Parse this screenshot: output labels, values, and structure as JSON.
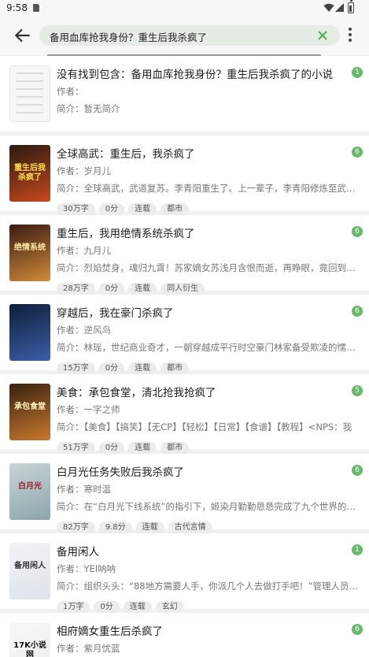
{
  "status_bar": {
    "time": "9:58"
  },
  "search": {
    "query": "备用血库抢我身份？重生后我杀疯了"
  },
  "results": [
    {
      "title": "没有找到包含：备用血库抢我身份？重生后我杀疯了的小说",
      "author": "作者：",
      "intro": "简介：暂无简介",
      "count": "1",
      "tags": [],
      "cover": {
        "style": "blank"
      }
    },
    {
      "title": "全球高武：重生后，我杀疯了",
      "author": "作者：岁月儿",
      "intro": "简介：全球高武，武道复苏。李青阳重生了。上一辈子，李青阳修炼至武道巅峰，",
      "count": "6",
      "tags": [
        "30万字",
        "0分",
        "连载",
        "都市"
      ],
      "cover": {
        "bg1": "#2a1a12",
        "bg2": "#c8481c",
        "text": "重生后我杀疯了",
        "fg": "#ffe04a"
      }
    },
    {
      "title": "重生后，我用绝情系统杀疯了",
      "author": "作者：九月儿",
      "intro": "简介：烈焰焚身，魂归九霄！苏家嫡女苏浅月含恨而逝，再睁眼，竟回到十五岁被",
      "count": "6",
      "tags": [
        "28万字",
        "0分",
        "连载",
        "同人衍生"
      ],
      "cover": {
        "bg1": "#3b1a12",
        "bg2": "#d08a3a",
        "text": "绝情系统",
        "fg": "#ffe9a8"
      }
    },
    {
      "title": "穿越后，我在豪门杀疯了",
      "author": "作者：逆风鸟",
      "intro": "简介：林瑶，世纪商业奇才，一朝穿越成平行时空豪门林家备受欺凌的懦弱千金",
      "count": "6",
      "tags": [
        "15万字",
        "0分",
        "连载",
        "都市"
      ],
      "cover": {
        "bg1": "#0f1d3a",
        "bg2": "#3a5fa8",
        "text": "",
        "fg": "#ffffff"
      }
    },
    {
      "title": "美食：承包食堂，清北抢我抢疯了",
      "author": "作者：一字之师",
      "intro": "简介：【美食】【搞笑】【无CP】【轻松】【日常】【食谱】【教程】<NPS：我",
      "count": "5",
      "tags": [
        "51万字",
        "0分",
        "连载",
        "都市"
      ],
      "cover": {
        "bg1": "#3a2210",
        "bg2": "#c9782e",
        "text": "承包食堂",
        "fg": "#fff2c0"
      }
    },
    {
      "title": "白月光任务失败后我杀疯了",
      "author": "作者：寒时温",
      "intro": "简介：在“白月光下线系统”的指引下，姬染月勤勤恳恳完成了九个世界的下线任务，",
      "count": "6",
      "tags": [
        "82万字",
        "9.8分",
        "连载",
        "古代言情"
      ],
      "cover": {
        "bg1": "#c9d4d6",
        "bg2": "#8aa7ab",
        "text": "白月光",
        "fg": "#a02030"
      }
    },
    {
      "title": "备用闲人",
      "author": "作者：YEI呐呐",
      "intro": "简介：组织头头：“88地方需要人手，你派几个人去做打手吧！”管理人员刷刷的查",
      "count": "1",
      "tags": [
        "1万字",
        "0分",
        "连载",
        "玄幻"
      ],
      "cover": {
        "bg1": "#f2f4f6",
        "bg2": "#dde3ea",
        "text": "备用闲人",
        "fg": "#333333"
      }
    },
    {
      "title": "相府嫡女重生后杀疯了",
      "author": "作者：紫月忧蓝",
      "intro": "简介：",
      "count": "6",
      "tags": [],
      "cover": {
        "bg1": "#f7f7f7",
        "bg2": "#eeeeee",
        "text": "17K小说网",
        "fg": "#111111"
      }
    }
  ]
}
